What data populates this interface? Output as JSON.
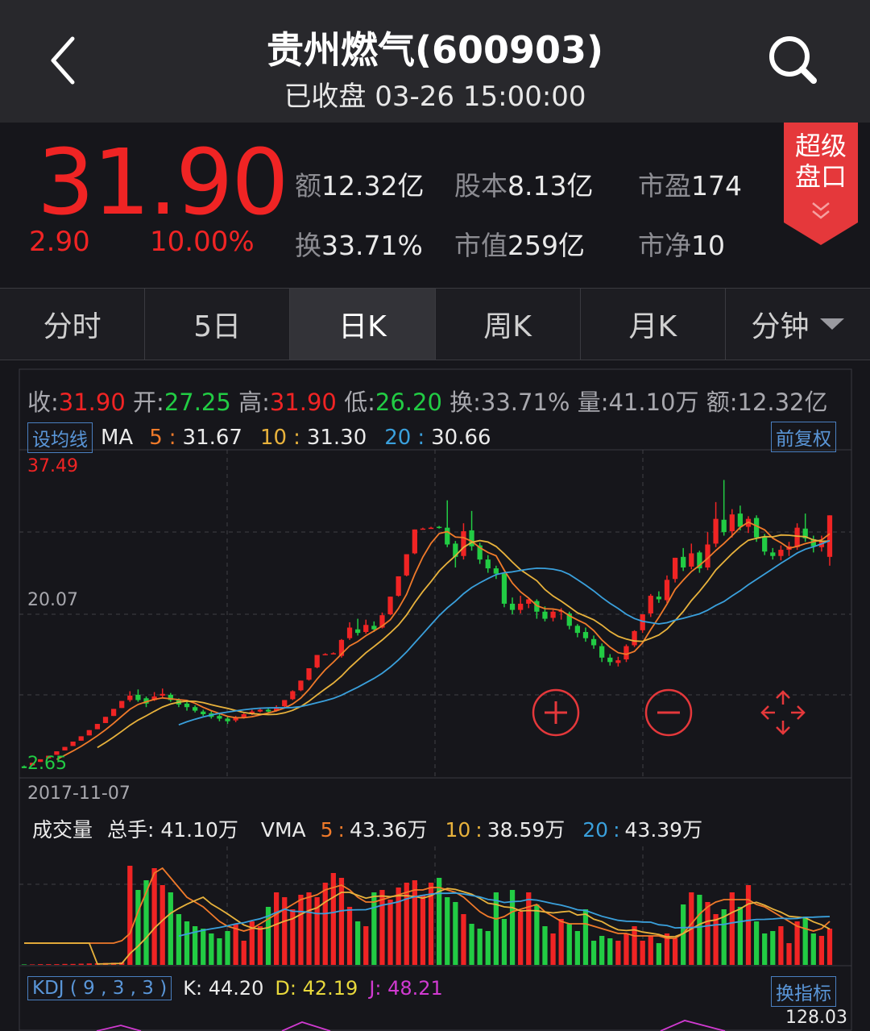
{
  "header": {
    "title": "贵州燃气(600903)",
    "status": "已收盘 03-26 15:00:00"
  },
  "quote": {
    "price": "31.90",
    "change": "2.90",
    "change_pct": "10.00%",
    "stats": [
      {
        "k": "额",
        "v": "12.32亿"
      },
      {
        "k": "股本",
        "v": "8.13亿"
      },
      {
        "k": "市盈",
        "v": "174"
      },
      {
        "k": "换",
        "v": "33.71%"
      },
      {
        "k": "市值",
        "v": "259亿"
      },
      {
        "k": "市净",
        "v": "10"
      }
    ],
    "super_label_1": "超级",
    "super_label_2": "盘口"
  },
  "tabs": [
    "分时",
    "5日",
    "日K",
    "周K",
    "月K",
    "分钟"
  ],
  "ohlc": {
    "close_k": "收:",
    "close_v": "31.90",
    "open_k": "开:",
    "open_v": "27.25",
    "high_k": "高:",
    "high_v": "31.90",
    "low_k": "低:",
    "low_v": "26.20",
    "turnover": "换:33.71%",
    "volume": "量:41.10万",
    "amount": "额:12.32亿"
  },
  "ma": {
    "set_label": "设均线",
    "ma_label": "MA",
    "ma5_k": "5",
    "ma5_v": "31.67",
    "ma10_k": "10",
    "ma10_v": "31.30",
    "ma20_k": "20",
    "ma20_v": "30.66",
    "adjust_label": "前复权",
    "sep": ":"
  },
  "chart_axis": {
    "y_top": "37.49",
    "y_mid": "20.07",
    "y_bottom": "2.65",
    "date_start": "2017-11-07"
  },
  "volume": {
    "title": "成交量",
    "total": "总手: 41.10万",
    "vma_label": "VMA",
    "vma5_k": "5",
    "vma5_v": "43.36万",
    "vma10_k": "10",
    "vma10_v": "38.59万",
    "vma20_k": "20",
    "vma20_v": "43.39万",
    "sep": ":"
  },
  "kdj": {
    "label": "KDJ ( 9 , 3 , 3 )",
    "k": "K: 44.20",
    "d": "D: 42.19",
    "j": "J: 48.21",
    "switch_label": "换指标",
    "axis_value": "128.03"
  },
  "colors": {
    "up": "#f02424",
    "down": "#22cc44",
    "ma5": "#f07a2a",
    "ma10": "#e8b23c",
    "ma20": "#3aa0dc",
    "kdj_j": "#d13ad1",
    "accent": "#e5383b"
  },
  "chart_data": {
    "type": "candlestick",
    "y_range": [
      2.65,
      37.49
    ],
    "ylabel": "",
    "candles": [
      [
        3.5,
        3.3,
        3.6,
        3.3
      ],
      [
        3.6,
        3.9,
        3.9,
        3.6
      ],
      [
        4.0,
        4.3,
        4.3,
        4.0
      ],
      [
        4.4,
        4.7,
        4.7,
        4.4
      ],
      [
        4.8,
        5.2,
        5.2,
        4.8
      ],
      [
        5.3,
        5.7,
        5.7,
        5.3
      ],
      [
        5.8,
        6.3,
        6.3,
        5.8
      ],
      [
        6.4,
        6.9,
        6.9,
        6.4
      ],
      [
        7.0,
        7.6,
        7.6,
        7.0
      ],
      [
        7.7,
        8.3,
        8.3,
        7.7
      ],
      [
        8.4,
        9.1,
        9.1,
        8.4
      ],
      [
        9.2,
        10.0,
        10.0,
        9.2
      ],
      [
        10.1,
        10.9,
        10.9,
        10.1
      ],
      [
        11.0,
        11.5,
        12.0,
        10.8
      ],
      [
        11.6,
        11.0,
        12.2,
        10.8
      ],
      [
        11.2,
        10.6,
        11.4,
        10.2
      ],
      [
        11.0,
        11.4,
        11.9,
        10.9
      ],
      [
        11.5,
        11.7,
        12.3,
        11.3
      ],
      [
        11.6,
        11.0,
        11.8,
        10.8
      ],
      [
        11.0,
        10.5,
        11.2,
        10.2
      ],
      [
        10.6,
        10.2,
        10.8,
        9.8
      ],
      [
        10.2,
        9.8,
        10.4,
        9.6
      ],
      [
        9.7,
        9.4,
        9.9,
        9.2
      ],
      [
        9.5,
        9.1,
        9.8,
        8.9
      ],
      [
        9.2,
        8.9,
        9.5,
        8.6
      ],
      [
        8.9,
        8.6,
        9.1,
        8.3
      ],
      [
        8.7,
        9.0,
        9.2,
        8.5
      ],
      [
        9.0,
        9.4,
        9.5,
        8.9
      ],
      [
        9.4,
        9.7,
        9.9,
        9.3
      ],
      [
        9.7,
        9.9,
        10.1,
        9.6
      ],
      [
        9.9,
        9.7,
        10.1,
        9.5
      ],
      [
        9.8,
        10.2,
        10.4,
        9.7
      ],
      [
        10.3,
        11.0,
        11.0,
        10.2
      ],
      [
        11.1,
        12.0,
        12.1,
        11.0
      ],
      [
        12.1,
        13.2,
        13.2,
        12.0
      ],
      [
        13.3,
        14.6,
        14.6,
        13.2
      ],
      [
        14.7,
        16.1,
        16.1,
        14.6
      ],
      [
        16.2,
        16.2,
        16.3,
        16.2
      ],
      [
        16.3,
        16.3,
        16.4,
        16.2
      ],
      [
        16.0,
        17.8,
        17.9,
        15.8
      ],
      [
        18.0,
        19.2,
        19.8,
        17.8
      ],
      [
        19.0,
        18.6,
        20.2,
        18.3
      ],
      [
        18.7,
        19.5,
        20.1,
        18.5
      ],
      [
        19.4,
        19.0,
        19.9,
        18.7
      ],
      [
        19.2,
        20.6,
        20.9,
        19.1
      ],
      [
        20.7,
        22.7,
        22.7,
        20.6
      ],
      [
        22.8,
        25.0,
        25.0,
        22.7
      ],
      [
        25.1,
        27.5,
        27.5,
        25.0
      ],
      [
        27.6,
        30.3,
        30.3,
        27.5
      ],
      [
        30.4,
        30.4,
        30.5,
        30.3
      ],
      [
        30.5,
        30.5,
        30.6,
        30.4
      ],
      [
        30.6,
        30.5,
        30.7,
        30.4
      ],
      [
        30.5,
        28.6,
        33.6,
        28.3
      ],
      [
        28.7,
        27.2,
        29.0,
        26.0
      ],
      [
        27.3,
        30.1,
        31.0,
        26.9
      ],
      [
        30.2,
        28.4,
        32.4,
        27.9
      ],
      [
        28.5,
        26.9,
        28.8,
        26.4
      ],
      [
        26.9,
        25.9,
        27.4,
        25.4
      ],
      [
        25.9,
        25.3,
        26.2,
        24.7
      ],
      [
        25.3,
        21.9,
        25.4,
        21.5
      ],
      [
        21.9,
        21.2,
        22.6,
        20.7
      ],
      [
        21.2,
        21.9,
        22.8,
        20.8
      ],
      [
        21.9,
        22.4,
        22.6,
        21.4
      ],
      [
        22.2,
        21.0,
        22.4,
        20.2
      ],
      [
        21.0,
        20.2,
        21.6,
        19.9
      ],
      [
        20.3,
        21.0,
        21.2,
        19.9
      ],
      [
        21.0,
        21.1,
        21.4,
        20.1
      ],
      [
        20.8,
        19.4,
        21.0,
        19.0
      ],
      [
        19.4,
        18.6,
        19.6,
        18.1
      ],
      [
        18.7,
        18.0,
        19.2,
        17.6
      ],
      [
        17.9,
        17.2,
        18.3,
        16.8
      ],
      [
        17.1,
        15.8,
        17.4,
        15.3
      ],
      [
        15.8,
        15.3,
        16.2,
        14.9
      ],
      [
        15.2,
        15.5,
        15.9,
        14.8
      ],
      [
        15.6,
        17.1,
        17.3,
        15.3
      ],
      [
        17.2,
        18.8,
        18.9,
        17.0
      ],
      [
        18.9,
        20.7,
        20.7,
        18.6
      ],
      [
        20.8,
        22.8,
        23.0,
        20.4
      ],
      [
        22.7,
        22.4,
        23.3,
        22.0
      ],
      [
        22.3,
        24.6,
        25.1,
        22.0
      ],
      [
        24.7,
        27.1,
        27.1,
        24.3
      ],
      [
        27.2,
        26.0,
        28.2,
        25.6
      ],
      [
        26.1,
        27.6,
        28.7,
        25.8
      ],
      [
        27.7,
        25.9,
        27.9,
        25.4
      ],
      [
        26.0,
        28.6,
        30.0,
        25.7
      ],
      [
        28.7,
        31.5,
        33.4,
        28.3
      ],
      [
        31.4,
        30.0,
        35.9,
        29.6
      ],
      [
        30.1,
        32.0,
        32.6,
        29.4
      ],
      [
        32.1,
        30.6,
        33.0,
        30.2
      ],
      [
        30.6,
        31.5,
        31.8,
        29.9
      ],
      [
        31.6,
        29.4,
        31.9,
        28.9
      ],
      [
        29.4,
        27.8,
        29.8,
        27.4
      ],
      [
        27.7,
        27.3,
        28.2,
        26.9
      ],
      [
        27.3,
        28.0,
        28.5,
        26.8
      ],
      [
        28.0,
        28.4,
        28.9,
        27.3
      ],
      [
        28.3,
        30.5,
        31.0,
        28.0
      ],
      [
        30.4,
        29.3,
        32.1,
        28.9
      ],
      [
        29.2,
        28.4,
        29.6,
        27.7
      ],
      [
        28.3,
        29.0,
        29.6,
        27.8
      ],
      [
        27.2,
        31.9,
        31.9,
        26.2
      ]
    ],
    "volume": [
      0.2,
      0.2,
      0.3,
      0.3,
      0.3,
      0.4,
      0.4,
      0.5,
      0.6,
      0.7,
      0.8,
      0.9,
      1.1,
      41.0,
      31.0,
      35.0,
      40.0,
      33.0,
      30.0,
      21.0,
      18.0,
      16.0,
      15.0,
      13.0,
      11.0,
      14.0,
      17.0,
      10.0,
      18.0,
      16.0,
      24.0,
      30.0,
      28.0,
      23.0,
      29.0,
      30.0,
      28.0,
      34.0,
      38.0,
      36.0,
      24.0,
      18.0,
      16.0,
      30.0,
      31.0,
      27.0,
      32.0,
      34.0,
      35.0,
      29.0,
      34.0,
      36.0,
      28.0,
      26.0,
      21.0,
      17.0,
      15.0,
      14.0,
      30.0,
      19.0,
      31.0,
      22.0,
      30.0,
      25.0,
      16.0,
      13.0,
      19.0,
      17.0,
      14.0,
      23.0,
      10.0,
      12.0,
      11.0,
      10.0,
      13.0,
      16.0,
      10.0,
      12.0,
      9.0,
      13.0,
      11.0,
      25.0,
      30.0,
      29.0,
      26.0,
      21.0,
      23.0,
      30.0,
      24.0,
      33.0,
      18.0,
      13.0,
      14.0,
      16.0,
      9.0,
      18.0,
      20.0,
      13.0,
      12.0,
      15.0
    ],
    "vma5": [
      9,
      9,
      9,
      9,
      9,
      9,
      9,
      9,
      9,
      9,
      9,
      9,
      10,
      13,
      22,
      30,
      38,
      40,
      36,
      32,
      28,
      26,
      24,
      21,
      18,
      16,
      15,
      14,
      15,
      17,
      19,
      21,
      23,
      25,
      27,
      28,
      29,
      31,
      32,
      33,
      31,
      28,
      26,
      26,
      27,
      28,
      29,
      30,
      31,
      31,
      32,
      32,
      31,
      30,
      28,
      25,
      22,
      20,
      19,
      20,
      22,
      23,
      24,
      25,
      22,
      20,
      18,
      17,
      17,
      17,
      16,
      15,
      14,
      13,
      13,
      12,
      12,
      12,
      12,
      11,
      11,
      13,
      17,
      21,
      24,
      26,
      27,
      27,
      27,
      27,
      25,
      24,
      22,
      20,
      18,
      16,
      15,
      14,
      15,
      18
    ]
  }
}
